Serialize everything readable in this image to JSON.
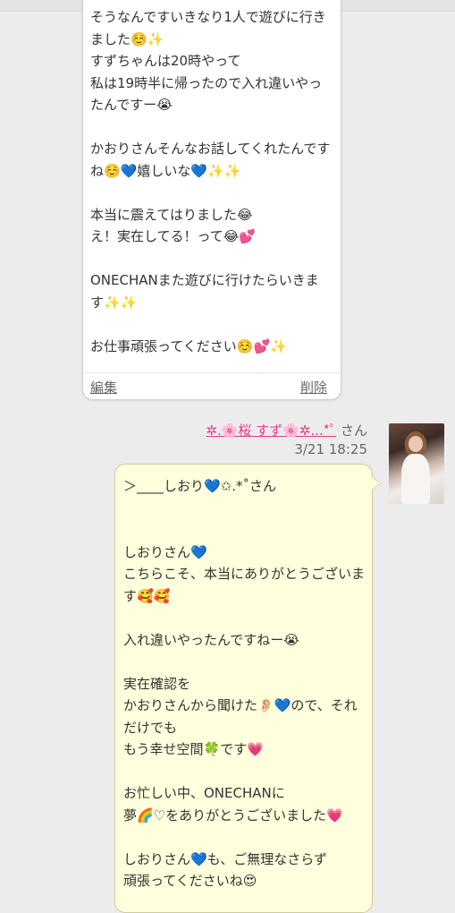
{
  "message_top": {
    "text": "そうなんですいきなり1人で遊びに行きました☺️✨\nすずちゃんは20時やって\n私は19時半に帰ったので入れ違いやったんですー😭\n\nかおりさんそんなお話してくれたんですね☺️💙嬉しいな💙✨✨\n\n本当に震えてはりました😂\nえ！実在してる！って😂💕\n\nONECHANまた遊びに行けたらいきます✨✨\n\nお仕事頑張ってください☺️💕✨",
    "edit_label": "編集",
    "delete_label": "削除"
  },
  "message_reply": {
    "sender_name": "✲.🌸桜 すず🌸✲...*ﾟ",
    "sender_suffix": " さん",
    "timestamp": "3/21 18:25",
    "text": "＞____しおり💙✩.*˚さん\n\n\nしおりさん💙\nこちらこそ、本当にありがとうございます🥰🥰\n\n入れ違いやったんですねー😭\n\n実在確認を\nかおりさんから聞けた👂🏻💙ので、それだけでも\nもう幸せ空間🍀です💗\n\nお忙しい中、ONECHANに\n夢🌈♡をありがとうございました💗\n\nしおりさん💙も、ご無理なさらず\n頑張ってくださいね😍"
  }
}
